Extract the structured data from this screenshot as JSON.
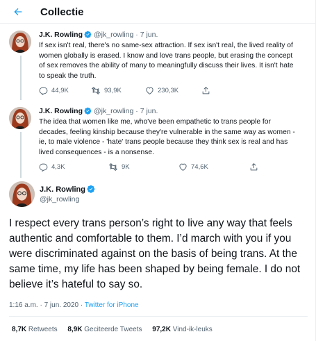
{
  "header": {
    "title": "Collectie"
  },
  "thread": [
    {
      "name": "J.K. Rowling",
      "handle": "@jk_rowling",
      "date": "7 jun.",
      "text": "If sex isn't real, there's no same-sex attraction. If sex isn't real, the lived reality of women globally is erased. I know and love trans people, but erasing the concept of sex removes the ability of many to meaningfully discuss their lives. It isn't hate to speak the truth.",
      "replies": "44,9K",
      "retweets": "93,9K",
      "likes": "230,3K"
    },
    {
      "name": "J.K. Rowling",
      "handle": "@jk_rowling",
      "date": "7 jun.",
      "text": "The idea that women like me, who've been empathetic to trans people for decades, feeling kinship because they're vulnerable in the same way as women - ie, to male violence - 'hate' trans people because they think sex is real and has lived consequences - is a nonsense.",
      "replies": "4,3K",
      "retweets": "9K",
      "likes": "74,6K"
    }
  ],
  "main": {
    "name": "J.K. Rowling",
    "handle": "@jk_rowling",
    "text": "I respect every trans person’s right to live any way that feels authentic and comfortable to them. I’d march with you if you were discriminated against on the basis of being trans. At the same time, my life has been shaped by being female. I do not believe it’s hateful to say so.",
    "timestamp": "1:16 a.m. · 7 jun. 2020 ·",
    "source": "Twitter for iPhone",
    "stats": {
      "retweets_count": "8,7K",
      "retweets_label": "Retweets",
      "quotes_count": "8,9K",
      "quotes_label": "Geciteerde Tweets",
      "likes_count": "97,2K",
      "likes_label": "Vind-ik-leuks"
    }
  },
  "colors": {
    "accent": "#1da1f2",
    "text": "#0f1419",
    "secondary": "#536471",
    "border": "#ebeef0"
  },
  "icons": [
    "back-arrow-icon",
    "verified-badge-icon",
    "reply-icon",
    "retweet-icon",
    "like-icon",
    "share-icon"
  ]
}
